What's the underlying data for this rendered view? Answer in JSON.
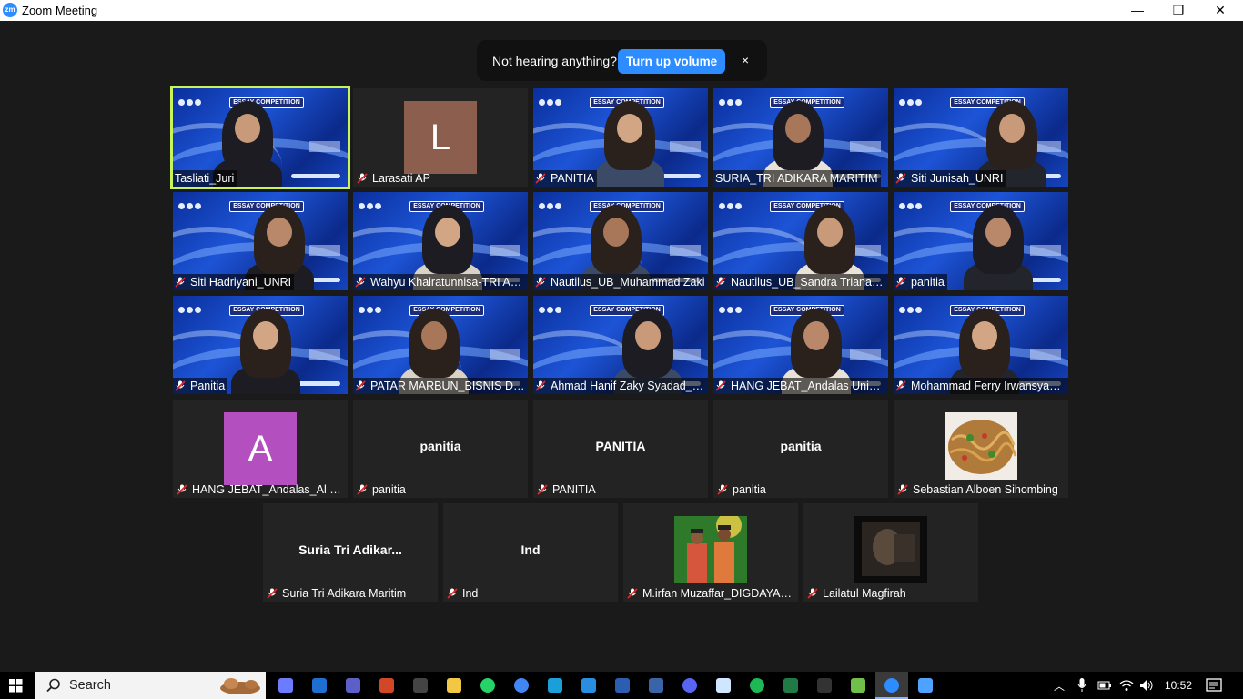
{
  "window": {
    "title": "Zoom Meeting",
    "minimize": "—",
    "restore": "❐",
    "close": "✕"
  },
  "toast": {
    "message": "Not hearing anything?",
    "button": "Turn up volume",
    "close": "×"
  },
  "video_banner": "ESSAY COMPETITION",
  "tiles": [
    {
      "name": "Tasliati_Juri",
      "type": "video",
      "muted": false,
      "active": true
    },
    {
      "name": "Larasati AP",
      "type": "avatar",
      "letter": "L",
      "color": "#8b5e4e",
      "muted": true
    },
    {
      "name": "PANITIA",
      "type": "video",
      "muted": true
    },
    {
      "name": "SURIA_TRI ADIKARA MARITIM",
      "type": "video",
      "muted": false
    },
    {
      "name": "Siti Junisah_UNRI",
      "type": "video",
      "muted": true
    },
    {
      "name": "Siti Hadriyani_UNRI",
      "type": "video",
      "muted": true
    },
    {
      "name": "Wahyu Khairatunnisa-TRI ADIKARA MARITIM",
      "type": "video",
      "muted": true
    },
    {
      "name": "Nautilus_UB_Muhammad Zaki",
      "type": "video",
      "muted": true
    },
    {
      "name": "Nautilus_UB_Sandra Triana Dewi",
      "type": "video",
      "muted": true
    },
    {
      "name": "panitia",
      "type": "video",
      "muted": true
    },
    {
      "name": "Panitia",
      "type": "video",
      "muted": true
    },
    {
      "name": "PATAR MARBUN_BISNIS DIGITAL",
      "type": "video",
      "muted": true
    },
    {
      "name": "Ahmad Hanif Zaky Syadad_UB",
      "type": "video",
      "muted": true
    },
    {
      "name": "HANG JEBAT_Andalas University",
      "type": "video",
      "muted": true
    },
    {
      "name": "Mohammad Ferry Irwansyah_UB",
      "type": "video",
      "muted": true
    },
    {
      "name": "HANG JEBAT_Andalas_Al Hakim",
      "type": "avatar",
      "letter": "A",
      "color": "#b44fc0",
      "muted": true
    },
    {
      "name": "panitia",
      "type": "name",
      "bigname": "panitia",
      "muted": true
    },
    {
      "name": "PANITIA",
      "type": "name",
      "bigname": "PANITIA",
      "muted": true
    },
    {
      "name": "panitia",
      "type": "name",
      "bigname": "panitia",
      "muted": true
    },
    {
      "name": "Sebastian Alboen Sihombing",
      "type": "photo",
      "photo": "food",
      "muted": true
    },
    {
      "name": "Suria Tri Adikara Maritim",
      "type": "name",
      "bigname": "Suria  Tri  Adikar...",
      "muted": true
    },
    {
      "name": "Ind",
      "type": "name",
      "bigname": "Ind",
      "muted": true
    },
    {
      "name": "M.irfan Muzaffar_DIGDAYA_UNAIR",
      "type": "photo",
      "photo": "people",
      "muted": true
    },
    {
      "name": "Lailatul Magfirah",
      "type": "photo",
      "photo": "dark",
      "muted": true
    }
  ],
  "taskbar": {
    "search_label": "Search",
    "clock": "10:52",
    "icons": [
      "copilot-icon",
      "outlook-icon",
      "teams-icon",
      "powerpoint-icon",
      "terminal-icon",
      "file-explorer-icon",
      "whatsapp-icon",
      "chrome-icon",
      "edge-icon",
      "vscode-icon",
      "word-icon",
      "powershell-icon",
      "discord-icon",
      "notepad-icon",
      "spotify-icon",
      "excel-icon",
      "cmd-icon",
      "vs-icon",
      "zoom-icon",
      "photos-icon"
    ]
  }
}
